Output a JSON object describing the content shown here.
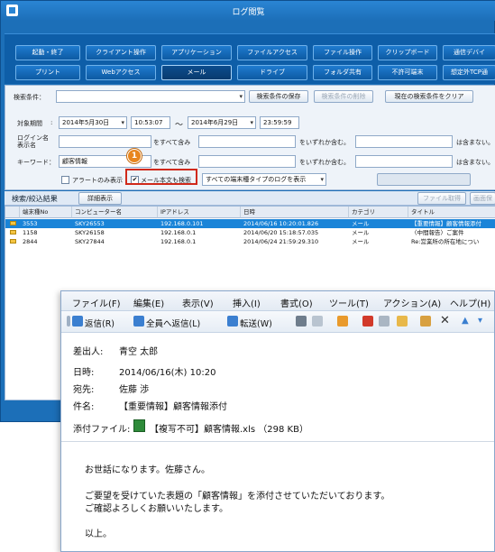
{
  "window": {
    "title": "ログ閲覧"
  },
  "tabs_row1": [
    "起動・終了",
    "クライアント操作",
    "アプリケーション",
    "ファイルアクセス",
    "ファイル操作",
    "クリップボード",
    "通信デバイ"
  ],
  "tabs_row2": [
    "プリント",
    "Webアクセス",
    "メール",
    "ドライブ",
    "フォルダ共有",
    "不許可端末",
    "想定外TCP通"
  ],
  "filter": {
    "condition_label": "検索条件：",
    "save_button": "検索条件の保存",
    "delete_button": "検索条件の削除",
    "clear_button": "現在の検索条件をクリア",
    "period_label": "対象期間",
    "date_from": "2014年5月30日",
    "time_from": "10:53:07",
    "tilde": "～",
    "date_to": "2014年6月29日",
    "time_to": "23:59:59",
    "login_label_1": "ログイン名",
    "login_label_2": "表示名",
    "keyword_label": "キーワード：",
    "keyword_value": "顧客情報",
    "all_include": "をすべて含み",
    "any_include": "をいずれか含む。",
    "not_include": "は含まない。",
    "alert_only": "アラートのみ表示",
    "mail_body_search": "メール本文も検索",
    "mail_body_checked": "✔",
    "log_type_select": "すべての端末種タイプのログを表示",
    "callout_number": "1"
  },
  "results": {
    "title": "検索/絞込結果",
    "detail_button": "詳細表示",
    "file_copy_button": "ファイル取得",
    "screen_button": "画面保",
    "columns": [
      "端末種No",
      "コンピューター名",
      "IPアドレス",
      "日時",
      "カテゴリ",
      "タイトル"
    ],
    "rows": [
      [
        "3553",
        "SKY26553",
        "192.168.0.101",
        "2014/06/16 10:20:01.826",
        "メール",
        "【重要情報】顧客情報添付"
      ],
      [
        "1158",
        "SKY26158",
        "192.168.0.1",
        "2014/06/20 15:18:57.035",
        "メール",
        "〈中間報告〉ご案件"
      ],
      [
        "2844",
        "SKY27844",
        "192.168.0.1",
        "2014/06/24 21:59:29.310",
        "メール",
        "Re:営業所の所在地につい"
      ]
    ]
  },
  "email": {
    "menu": [
      "ファイル(F)",
      "編集(E)",
      "表示(V)",
      "挿入(I)",
      "書式(O)",
      "ツール(T)",
      "アクション(A)",
      "ヘルプ(H)"
    ],
    "toolbar": {
      "reply": "返信(R)",
      "reply_all": "全員へ返信(L)",
      "forward": "転送(W)"
    },
    "from_label": "差出人:",
    "from_value": "青空 太郎",
    "date_label": "日時:",
    "date_value": "2014/06/16(木) 10:20",
    "to_label": "宛先:",
    "to_value": "佐藤 渉",
    "subject_label": "件名:",
    "subject_value": "【重要情報】顧客情報添付",
    "attach_label": "添付ファイル:",
    "attach_value": "【複写不可】顧客情報.xls （298 KB）",
    "body": [
      "お世話になります。佐藤さん。",
      "ご要望を受けていた表題の「顧客情報」を添付させていただいております。",
      "ご確認よろしくお願いいたします。",
      "以上。"
    ]
  },
  "colors": {
    "accent": "#1c6fb8",
    "selection": "#1a84d8",
    "highlight": "#d0291a",
    "callout": "#e8861f"
  }
}
